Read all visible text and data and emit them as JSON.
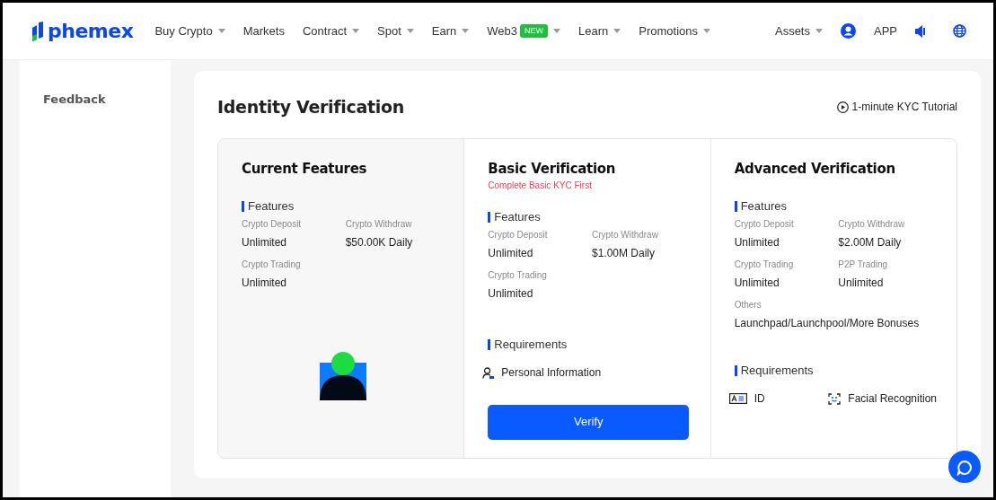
{
  "brand": {
    "name": "phemex"
  },
  "nav": [
    {
      "label": "Buy Crypto",
      "caret": true
    },
    {
      "label": "Markets",
      "caret": false
    },
    {
      "label": "Contract",
      "caret": true
    },
    {
      "label": "Spot",
      "caret": true
    },
    {
      "label": "Earn",
      "caret": true
    },
    {
      "label": "Web3",
      "caret": true,
      "badge": "NEW"
    },
    {
      "label": "Learn",
      "caret": true
    },
    {
      "label": "Promotions",
      "caret": true
    }
  ],
  "nav_right": {
    "assets": "Assets",
    "app": "APP"
  },
  "sidebar": {
    "items": [
      {
        "label": "Feedback"
      }
    ]
  },
  "page": {
    "title": "Identity Verification",
    "tutorial": "1-minute KYC Tutorial"
  },
  "tiers": [
    {
      "kind": "current",
      "title": "Current Features",
      "features_heading": "Features",
      "features": [
        {
          "label": "Crypto Deposit",
          "value": "Unlimited"
        },
        {
          "label": "Crypto Withdraw",
          "value": "$50.00K Daily"
        },
        {
          "label": "Crypto Trading",
          "value": "Unlimited"
        }
      ]
    },
    {
      "kind": "basic",
      "title": "Basic Verification",
      "note": "Complete Basic KYC First",
      "features_heading": "Features",
      "features": [
        {
          "label": "Crypto Deposit",
          "value": "Unlimited"
        },
        {
          "label": "Crypto Withdraw",
          "value": "$1.00M Daily"
        },
        {
          "label": "Crypto Trading",
          "value": "Unlimited"
        }
      ],
      "requirements_heading": "Requirements",
      "requirements": [
        {
          "kind": "person",
          "text": "Personal Information"
        }
      ],
      "button": "Verify"
    },
    {
      "kind": "advanced",
      "title": "Advanced Verification",
      "features_heading": "Features",
      "features": [
        {
          "label": "Crypto Deposit",
          "value": "Unlimited"
        },
        {
          "label": "Crypto Withdraw",
          "value": "$2.00M Daily"
        },
        {
          "label": "Crypto Trading",
          "value": "Unlimited"
        },
        {
          "label": "P2P Trading",
          "value": "Unlimited"
        },
        {
          "label": "Others",
          "value": "Launchpad/Launchpool/More Bonuses",
          "wide": true
        }
      ],
      "requirements_heading": "Requirements",
      "requirements": [
        {
          "kind": "id",
          "text": "ID"
        },
        {
          "kind": "face",
          "text": "Facial Recognition"
        }
      ]
    }
  ]
}
